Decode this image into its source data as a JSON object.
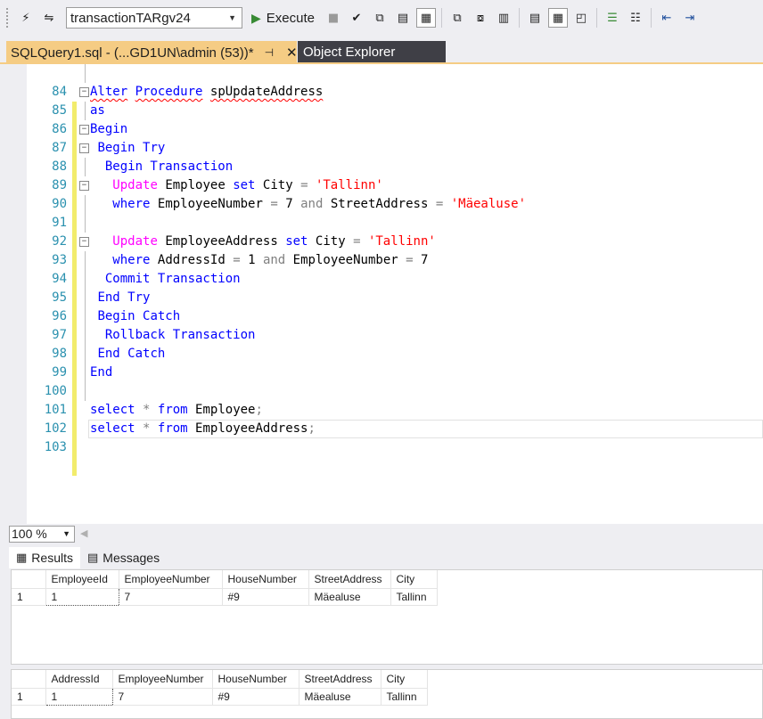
{
  "toolbar": {
    "database": "transactionTARgv24",
    "execute_label": "Execute"
  },
  "tabs": {
    "active": "SQLQuery1.sql - (...GD1UN\\admin (53))*",
    "pin": "⊣",
    "close": "✕",
    "inactive": "Object Explorer"
  },
  "editor": {
    "lines": [
      {
        "n": "84"
      },
      {
        "n": "85"
      },
      {
        "n": "86"
      },
      {
        "n": "87"
      },
      {
        "n": "88"
      },
      {
        "n": "89"
      },
      {
        "n": "90"
      },
      {
        "n": "91"
      },
      {
        "n": "92"
      },
      {
        "n": "93"
      },
      {
        "n": "94"
      },
      {
        "n": "95"
      },
      {
        "n": "96"
      },
      {
        "n": "97"
      },
      {
        "n": "98"
      },
      {
        "n": "99"
      },
      {
        "n": "100"
      },
      {
        "n": "101"
      },
      {
        "n": "102"
      },
      {
        "n": "103"
      }
    ],
    "code": {
      "l85": {
        "alter": "Alter",
        "procedure": "Procedure",
        "name": "spUpdateAddress"
      },
      "l86": {
        "as": "as"
      },
      "l87": {
        "begin": "Begin"
      },
      "l88": {
        "begin_try": "Begin Try"
      },
      "l89": {
        "begin_tran": "Begin Transaction"
      },
      "l90": {
        "update": "Update",
        "table": "Employee",
        "set": "set",
        "col": "City",
        "eq": "=",
        "val": "'Tallinn'"
      },
      "l91": {
        "where": "where",
        "col1": "EmployeeNumber",
        "eq1": "=",
        "val1": "7",
        "and": "and",
        "col2": "StreetAddress",
        "eq2": "=",
        "val2": "'Mäealuse'"
      },
      "l93": {
        "update": "Update",
        "table": "EmployeeAddress",
        "set": "set",
        "col": "City",
        "eq": "=",
        "val": "'Tallinn'"
      },
      "l94": {
        "where": "where",
        "col1": "AddressId",
        "eq1": "=",
        "val1": "1",
        "and": "and",
        "col2": "EmployeeNumber",
        "eq2": "=",
        "val2": "7"
      },
      "l95": {
        "commit": "Commit Transaction"
      },
      "l96": {
        "end_try": "End Try"
      },
      "l97": {
        "begin_catch": "Begin Catch"
      },
      "l98": {
        "rollback": "Rollback Transaction"
      },
      "l99": {
        "end_catch": "End Catch"
      },
      "l100": {
        "end": "End"
      },
      "l102": {
        "select": "select",
        "star": "*",
        "from": "from",
        "table": "Employee",
        "semi": ";"
      },
      "l103": {
        "select": "select",
        "star": "*",
        "from": "from",
        "table": "EmployeeAddress",
        "semi": ";"
      }
    }
  },
  "zoom": {
    "value": "100 %"
  },
  "result_tabs": {
    "results": "Results",
    "messages": "Messages"
  },
  "grid1": {
    "columns": [
      "EmployeeId",
      "EmployeeNumber",
      "HouseNumber",
      "StreetAddress",
      "City"
    ],
    "rows": [
      {
        "rn": "1",
        "cells": [
          "1",
          "7",
          "#9",
          "Mäealuse",
          "Tallinn"
        ]
      }
    ]
  },
  "grid2": {
    "columns": [
      "AddressId",
      "EmployeeNumber",
      "HouseNumber",
      "StreetAddress",
      "City"
    ],
    "rows": [
      {
        "rn": "1",
        "cells": [
          "1",
          "7",
          "#9",
          "Mäealuse",
          "Tallinn"
        ]
      }
    ]
  }
}
